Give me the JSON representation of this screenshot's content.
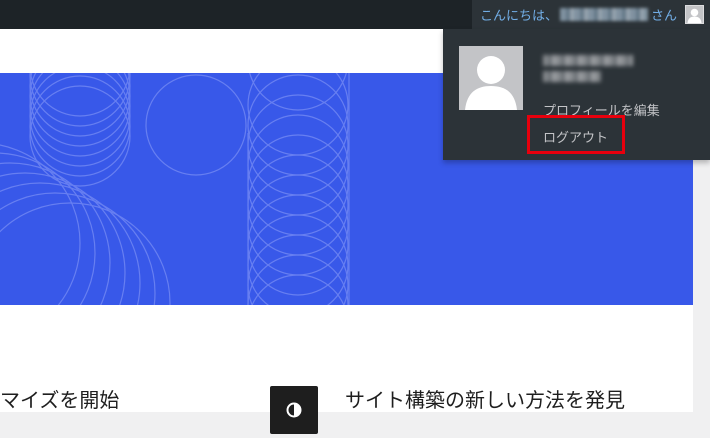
{
  "admin_bar": {
    "greeting_prefix": "こんにちは、",
    "greeting_suffix": "さん"
  },
  "user_menu": {
    "edit_profile": "プロフィールを編集",
    "logout": "ログアウト"
  },
  "content": {
    "feature_left_title": "マイズを開始",
    "feature_right_title": "サイト構築の新しい方法を発見"
  },
  "colors": {
    "admin_bar_bg": "#1d2327",
    "dropdown_bg": "#2c3338",
    "link_blue": "#72aee6",
    "hero_blue": "#3858e9",
    "highlight_red": "#e8000d"
  },
  "icons": [
    "user-avatar-icon",
    "site-editor-icon"
  ]
}
